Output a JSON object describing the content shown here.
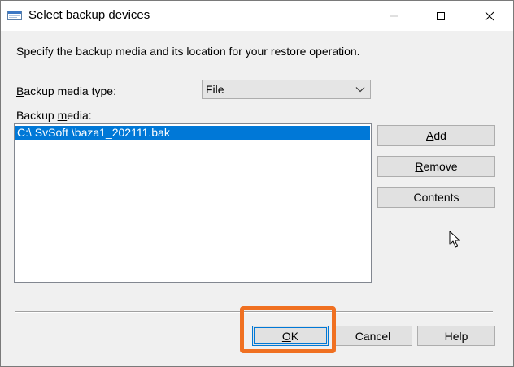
{
  "window": {
    "title": "Select backup devices"
  },
  "titlebar": {
    "app_icon": "dialog-window-icon",
    "minimize_icon": "minimize-icon",
    "maximize_icon": "maximize-icon",
    "close_icon": "close-icon"
  },
  "instruction": "Specify the backup media and its location for your restore operation.",
  "media_type": {
    "label_first": "B",
    "label_rest": "ackup media type:",
    "selected": "File"
  },
  "media": {
    "label_first": "Backup ",
    "label_underlined": "m",
    "label_rest": "edia:",
    "items": [
      "C:\\ SvSoft \\baza1_202111.bak"
    ]
  },
  "buttons": {
    "add_underlined": "A",
    "add_rest": "dd",
    "remove_underlined": "R",
    "remove_rest": "emove",
    "contents": "Contents",
    "ok_underlined": "O",
    "ok_rest": "K",
    "cancel": "Cancel",
    "help": "Help"
  },
  "colors": {
    "selection": "#0078d7",
    "highlight_frame": "#f07021",
    "dialog_bg": "#f0f0f0"
  }
}
